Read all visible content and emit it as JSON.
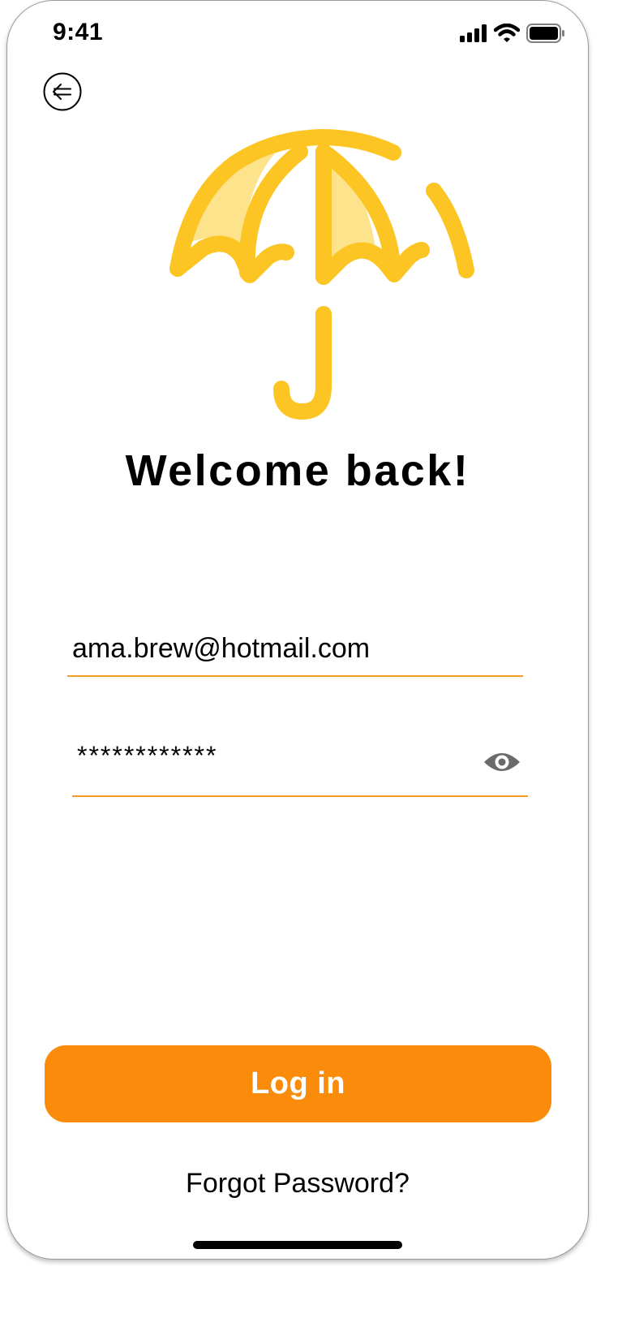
{
  "status_bar": {
    "time": "9:41",
    "icons": [
      "cellular-signal-icon",
      "wifi-icon",
      "battery-icon"
    ]
  },
  "header": {
    "back_icon": "back-arrow-icon"
  },
  "logo": {
    "icon": "umbrella-icon",
    "color": "#fcc524",
    "fill_color": "#fde38b"
  },
  "title": "Welcome back!",
  "form": {
    "email_value": "ama.brew@hotmail.com",
    "password_value": "************",
    "password_toggle_icon": "eye-icon",
    "underline_color": "#f39c25"
  },
  "login_button": {
    "label": "Log in",
    "color": "#fb8c0b"
  },
  "forgot_password": "Forgot Password?"
}
